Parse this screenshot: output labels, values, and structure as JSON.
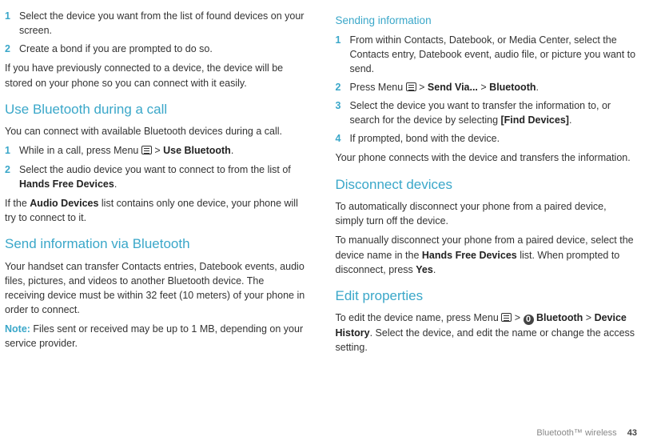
{
  "left": {
    "list1": [
      "Select the device you want from the list of found devices on your screen.",
      "Create a bond if you are prompted to do so."
    ],
    "p1": "If you have previously connected to a device, the device will be stored on your phone so you can connect with it easily.",
    "h2a": "Use Bluetooth during a call",
    "p2": "You can connect with available Bluetooth devices during a call.",
    "list2_1a": "While in a call, press Menu ",
    "list2_1b": " > ",
    "list2_1_bold": "Use Bluetooth",
    "list2_2a": "Select the audio device you want to connect to from the list of ",
    "list2_2_bold": "Hands Free Devices",
    "p3a": "If the ",
    "p3_bold": "Audio Devices",
    "p3b": " list contains only one device, your phone will try to connect to it.",
    "h2b": "Send information via Bluetooth",
    "p4": "Your handset can transfer Contacts entries, Datebook events, audio files, pictures, and videos to another Bluetooth device. The receiving device must be within 32 feet (10 meters) of your phone in order to connect.",
    "note_label": "Note:",
    "p5": " Files sent or received may be up to 1 MB, depending on your service provider."
  },
  "right": {
    "h3a": "Sending information",
    "rl1_1": "From within Contacts, Datebook, or Media Center, select the Contacts entry, Datebook event, audio file, or picture you want to send.",
    "rl1_2a": "Press Menu ",
    "rl1_2b": " > ",
    "rl1_2_bold1": "Send Via...",
    "rl1_2c": " > ",
    "rl1_2_bold2": "Bluetooth",
    "rl1_3a": "Select the device you want to transfer the information to, or search for the device by selecting ",
    "rl1_3_bold": "[Find Devices]",
    "rl1_4": "If prompted, bond with the device.",
    "rp1": "Your phone connects with the device and transfers the information.",
    "h2c": "Disconnect devices",
    "rp2": "To automatically disconnect your phone from a paired device, simply turn off the device.",
    "rp3a": "To manually disconnect your phone from a paired device, select the device name in the ",
    "rp3_bold1": "Hands Free Devices",
    "rp3b": " list. When prompted to disconnect, press ",
    "rp3_bold2": "Yes",
    "h2d": "Edit properties",
    "rp4a": "To edit the device name, press Menu ",
    "rp4b": " > ",
    "rp4c": " ",
    "rp4_bold1": "Bluetooth",
    "rp4d": " > ",
    "rp4_bold2": "Device History",
    "rp4e": ". Select the device, and edit the name or change the access setting."
  },
  "footer": {
    "section": "Bluetooth™ wireless",
    "page": "43"
  },
  "nums": {
    "n1": "1",
    "n2": "2",
    "n3": "3",
    "n4": "4"
  }
}
